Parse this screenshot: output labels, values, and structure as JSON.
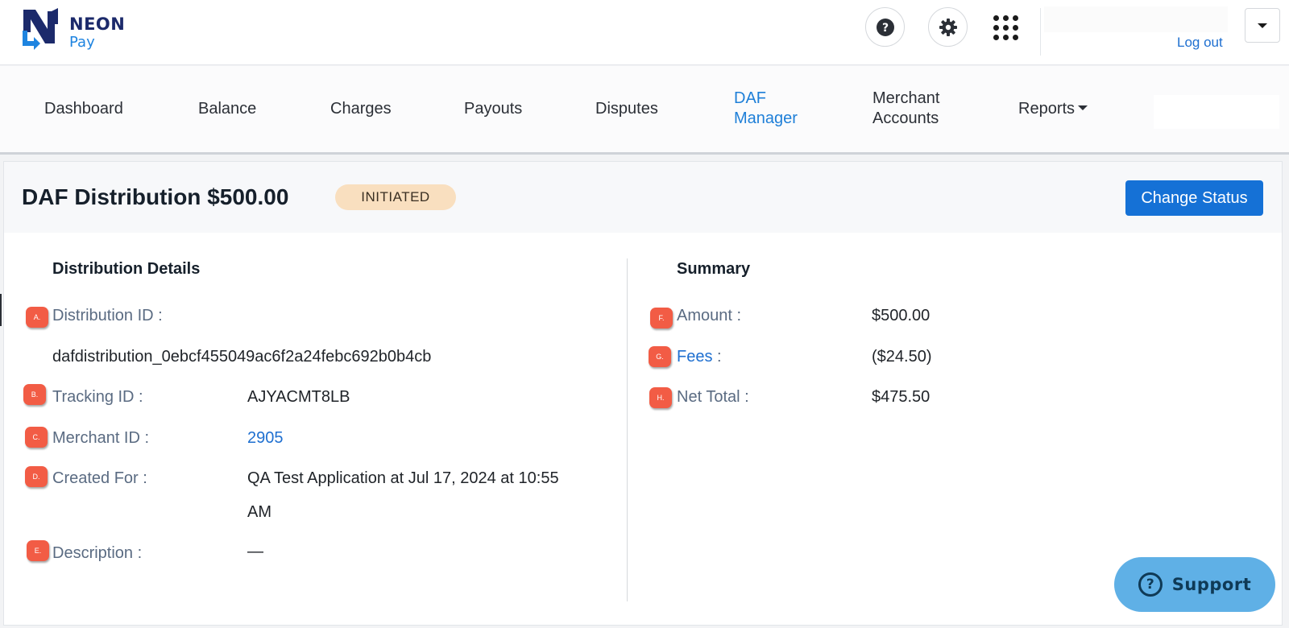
{
  "brand": {
    "name_line1": "NEON",
    "name_line2": "Pay",
    "primary": "#1c2a6b",
    "accent": "#1e84e0"
  },
  "header": {
    "help_icon": "question-circle-icon",
    "settings_icon": "gear-icon",
    "apps_icon": "grid-icon",
    "logout_label": "Log out",
    "account_dropdown_icon": "caret-down-icon"
  },
  "nav": {
    "items": [
      {
        "label": "Dashboard"
      },
      {
        "label": "Balance"
      },
      {
        "label": "Charges"
      },
      {
        "label": "Payouts"
      },
      {
        "label": "Disputes"
      },
      {
        "label_line1": "DAF",
        "label_line2": "Manager",
        "active": true
      },
      {
        "label_line1": "Merchant",
        "label_line2": "Accounts"
      },
      {
        "label": "Reports",
        "has_dropdown": true
      }
    ],
    "active_color": "#1e7fd8"
  },
  "page": {
    "title": "DAF Distribution $500.00",
    "status": "INITIATED",
    "status_color": "#f9dfbf",
    "change_status_label": "Change Status",
    "button_color": "#1571d6"
  },
  "details": {
    "title": "Distribution Details",
    "rows": [
      {
        "marker": "A.",
        "label": "Distribution ID :",
        "value": "dafdistribution_0ebcf455049ac6f2a24febc692b0b4cb"
      },
      {
        "marker": "B.",
        "label": "Tracking ID :",
        "value": "AJYACMT8LB"
      },
      {
        "marker": "C.",
        "label": "Merchant ID :",
        "value": "2905"
      },
      {
        "marker": "D.",
        "label": "Created For :",
        "value_line1": "QA Test Application at Jul 17, 2024 at 10:55",
        "value_line2": "AM"
      },
      {
        "marker": "E.",
        "label": "Description :",
        "value": "—"
      }
    ]
  },
  "summary": {
    "title": "Summary",
    "rows": [
      {
        "marker": "F.",
        "label": "Amount :",
        "value": "$500.00"
      },
      {
        "marker": "G.",
        "label": "Fees",
        "colon": " :",
        "value": "($24.50)"
      },
      {
        "marker": "H.",
        "label": "Net Total :",
        "value": "$475.50"
      }
    ]
  },
  "support": {
    "label": "Support",
    "icon": "question-circle-icon",
    "color": "#5fb0e6"
  },
  "marker_color": "#f25c45"
}
